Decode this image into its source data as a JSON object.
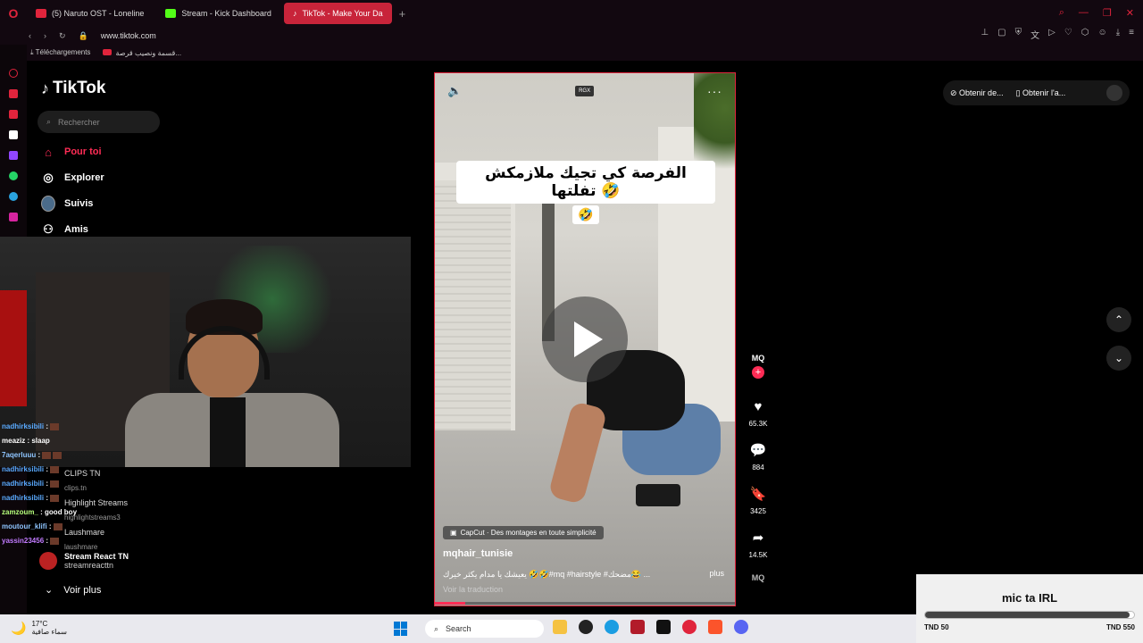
{
  "browser": {
    "tabs": [
      {
        "label": "(5) Naruto OST - Loneline",
        "icon": "youtube-icon",
        "color": "#e0243c",
        "active": false
      },
      {
        "label": "Stream - Kick Dashboard",
        "icon": "kick-icon",
        "color": "#53fc18",
        "active": false
      },
      {
        "label": "TikTok - Make Your Da",
        "icon": "tiktok-icon",
        "color": "#111111",
        "active": true
      }
    ],
    "url": "www.tiktok.com",
    "bookmarks": [
      "Téléchargements",
      "قسمة ونصيب قرصة..."
    ]
  },
  "tiktok": {
    "logo": "TikTok",
    "search_placeholder": "Rechercher",
    "nav": [
      {
        "label": "Pour toi",
        "icon": "home-icon",
        "active": true
      },
      {
        "label": "Explorer",
        "icon": "compass-icon",
        "active": false
      },
      {
        "label": "Suivis",
        "icon": "avatar-icon",
        "active": false
      },
      {
        "label": "Amis",
        "icon": "friends-icon",
        "active": false
      }
    ],
    "suggested": [
      {
        "name": "CLIPS TN",
        "handle": "clips.tn"
      },
      {
        "name": "Highlight Streams",
        "handle": "highlightstreams3"
      },
      {
        "name": "Laushmare",
        "handle": "laushmare"
      }
    ],
    "stream_react": {
      "name": "Stream React TN",
      "handle": "streamreacttn"
    },
    "voir_plus": "Voir plus",
    "video": {
      "caption_text": "الفرصة كي تجيك ملازمكش تفلتها 🤣",
      "caption_emoji": "🤣",
      "watermark": "RGX",
      "capcut": "CapCut · Des montages en toute simplicité",
      "author": "mqhair_tunisie",
      "description": "يعيشك يا مدام يكثر خيرك 🤣🤣#mq #hairstyle #مضحك😂 ...",
      "more": "plus",
      "translate": "Voir la traduction",
      "progress": 0.1
    },
    "actions": {
      "creator_tag": "MQ",
      "likes": "65.3K",
      "comments": "884",
      "saves": "3425",
      "shares": "14.5K"
    },
    "chips": [
      "Obtenir de...",
      "Obtenir l'a..."
    ]
  },
  "chat": [
    {
      "user": "nadhirksibili",
      "message": ":",
      "color": "#5aaaff"
    },
    {
      "user": "meaziz",
      "message": ": slaap",
      "color": "#ffffff"
    },
    {
      "user": "7aqerluuu",
      "message": ":",
      "color": "#8ec5ff"
    },
    {
      "user": "nadhirksibili",
      "message": ":",
      "color": "#5aaaff"
    },
    {
      "user": "nadhirksibili",
      "message": ":",
      "color": "#5aaaff"
    },
    {
      "user": "nadhirksibili",
      "message": ":",
      "color": "#5aaaff"
    },
    {
      "user": "zamzoum_",
      "message": ": good boy",
      "color": "#b6ff7b"
    },
    {
      "user": "moutour_klifi",
      "message": ":",
      "color": "#8ec5ff"
    },
    {
      "user": "yassin23456",
      "message": ":",
      "color": "#c27bff"
    }
  ],
  "donation": {
    "title": "mic ta IRL",
    "min": "TND 50",
    "max": "TND 550",
    "progress": 0.98
  },
  "taskbar": {
    "temp": "17°C",
    "weather_desc": "سماء صافية",
    "search": "Search"
  }
}
